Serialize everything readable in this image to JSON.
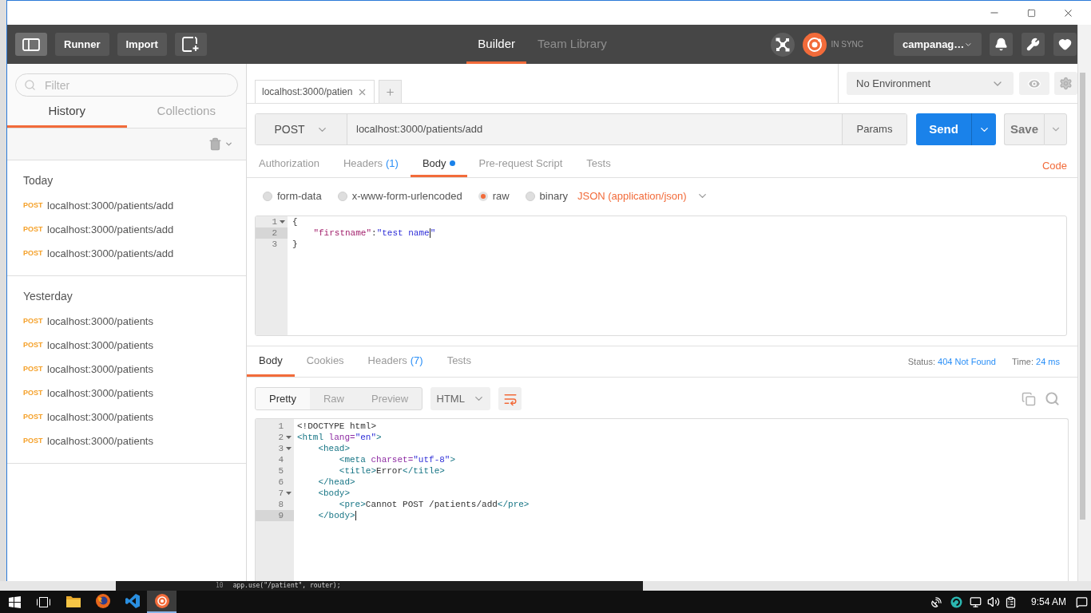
{
  "toolbar": {
    "sidebar_toggle": {
      "on": true
    },
    "buttons": [
      "Runner",
      "Import"
    ],
    "views": [
      {
        "label": "Builder",
        "selected": true
      },
      {
        "label": "Team Library",
        "selected": false
      }
    ],
    "sync": {
      "label": "IN SYNC"
    },
    "user": {
      "label": "campanag…"
    }
  },
  "sidebar": {
    "filter": {
      "placeholder": "Filter"
    },
    "tabs": [
      {
        "label": "History",
        "selected": true
      },
      {
        "label": "Collections",
        "selected": false
      }
    ],
    "groups": [
      {
        "label": "Today",
        "items": [
          {
            "method": "POST",
            "url": "localhost:3000/patients/add"
          },
          {
            "method": "POST",
            "url": "localhost:3000/patients/add"
          },
          {
            "method": "POST",
            "url": "localhost:3000/patients/add"
          }
        ]
      },
      {
        "label": "Yesterday",
        "items": [
          {
            "method": "POST",
            "url": "localhost:3000/patients"
          },
          {
            "method": "POST",
            "url": "localhost:3000/patients"
          },
          {
            "method": "POST",
            "url": "localhost:3000/patients"
          },
          {
            "method": "POST",
            "url": "localhost:3000/patients"
          },
          {
            "method": "POST",
            "url": "localhost:3000/patients"
          },
          {
            "method": "POST",
            "url": "localhost:3000/patients"
          }
        ]
      }
    ]
  },
  "request_tabs": [
    {
      "label": "localhost:3000/patien"
    }
  ],
  "environment": {
    "value": "No Environment"
  },
  "request": {
    "method": "POST",
    "url": "localhost:3000/patients/add",
    "params_label": "Params",
    "send_label": "Send",
    "save_label": "Save",
    "tabs": [
      {
        "label": "Authorization",
        "selected": false,
        "indicator": false
      },
      {
        "label": "Headers",
        "count": "(1)",
        "selected": false,
        "indicator": false
      },
      {
        "label": "Body",
        "selected": true,
        "indicator": true
      },
      {
        "label": "Pre-request Script",
        "selected": false,
        "indicator": false
      },
      {
        "label": "Tests",
        "selected": false,
        "indicator": false
      }
    ],
    "code_link": "Code",
    "body_modes": [
      {
        "label": "form-data",
        "selected": false
      },
      {
        "label": "x-www-form-urlencoded",
        "selected": false
      },
      {
        "label": "raw",
        "selected": true
      },
      {
        "label": "binary",
        "selected": false
      }
    ],
    "content_type": "JSON (application/json)",
    "editor": {
      "lines": [
        {
          "number": "1",
          "fold": true,
          "active": false,
          "tokens": [
            {
              "kind": "plain",
              "text": "{"
            }
          ]
        },
        {
          "number": "2",
          "fold": false,
          "active": true,
          "tokens": [
            {
              "kind": "key",
              "text": "    \"firstname\""
            },
            {
              "kind": "plain",
              "text": ":"
            },
            {
              "kind": "string",
              "text": "\"test name"
            },
            {
              "kind": "cursor"
            },
            {
              "kind": "string",
              "text": "\""
            }
          ]
        },
        {
          "number": "3",
          "fold": false,
          "active": false,
          "tokens": [
            {
              "kind": "plain",
              "text": "}"
            }
          ]
        }
      ]
    }
  },
  "response": {
    "tabs": [
      {
        "label": "Body",
        "selected": true
      },
      {
        "label": "Cookies",
        "selected": false
      },
      {
        "label": "Headers",
        "count": "(7)",
        "selected": false
      },
      {
        "label": "Tests",
        "selected": false
      }
    ],
    "status": {
      "label": "Status:",
      "value": "404 Not Found"
    },
    "time": {
      "label": "Time:",
      "value": "24 ms"
    },
    "views": [
      {
        "label": "Pretty",
        "selected": true
      },
      {
        "label": "Raw",
        "selected": false
      },
      {
        "label": "Preview",
        "selected": false
      }
    ],
    "format": "HTML",
    "wrap": true,
    "editor": {
      "lines": [
        {
          "number": "1",
          "fold": false,
          "active": false,
          "tokens": [
            {
              "kind": "doctype",
              "text": "<!DOCTYPE html>"
            }
          ]
        },
        {
          "number": "2",
          "fold": true,
          "active": false,
          "tokens": [
            {
              "kind": "tag",
              "text": "<html"
            },
            {
              "kind": "attr",
              "text": " lang="
            },
            {
              "kind": "string",
              "text": "\"en\""
            },
            {
              "kind": "tag",
              "text": ">"
            }
          ]
        },
        {
          "number": "3",
          "fold": true,
          "active": false,
          "tokens": [
            {
              "kind": "tag",
              "text": "    <head>"
            }
          ]
        },
        {
          "number": "4",
          "fold": false,
          "active": false,
          "tokens": [
            {
              "kind": "tag",
              "text": "        <meta"
            },
            {
              "kind": "attr",
              "text": " charset="
            },
            {
              "kind": "string",
              "text": "\"utf-8\""
            },
            {
              "kind": "tag",
              "text": ">"
            }
          ]
        },
        {
          "number": "5",
          "fold": false,
          "active": false,
          "tokens": [
            {
              "kind": "tag",
              "text": "        <title>"
            },
            {
              "kind": "plain",
              "text": "Error"
            },
            {
              "kind": "tag",
              "text": "</title>"
            }
          ]
        },
        {
          "number": "6",
          "fold": false,
          "active": false,
          "tokens": [
            {
              "kind": "tag",
              "text": "    </head>"
            }
          ]
        },
        {
          "number": "7",
          "fold": true,
          "active": false,
          "tokens": [
            {
              "kind": "tag",
              "text": "    <body>"
            }
          ]
        },
        {
          "number": "8",
          "fold": false,
          "active": false,
          "tokens": [
            {
              "kind": "tag",
              "text": "        <pre>"
            },
            {
              "kind": "plain",
              "text": "Cannot POST /patients/add"
            },
            {
              "kind": "tag",
              "text": "</pre>"
            }
          ]
        },
        {
          "number": "9",
          "fold": false,
          "active": true,
          "tokens": [
            {
              "kind": "tag",
              "text": "    </body>"
            },
            {
              "kind": "cursor"
            }
          ]
        }
      ]
    }
  },
  "background_window": {
    "line_number": "10",
    "code": "app.use(\"/patient\", router);"
  },
  "taskbar": {
    "apps": [
      {
        "kind": "folder",
        "active": false
      },
      {
        "kind": "globe",
        "active": false
      },
      {
        "kind": "ribbon",
        "active": false
      },
      {
        "kind": "target",
        "active": true
      }
    ],
    "clock": "9:54 AM"
  }
}
